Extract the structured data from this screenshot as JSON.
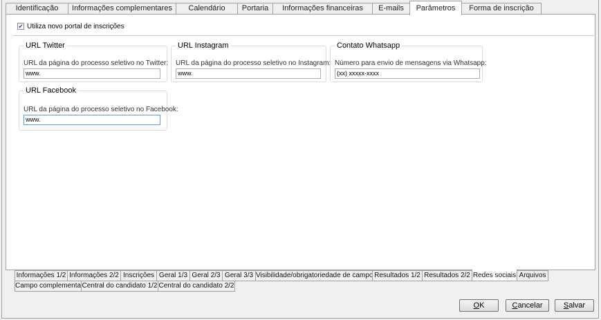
{
  "top_tabs": [
    {
      "label": "Identificação"
    },
    {
      "label": "Informações complementares"
    },
    {
      "label": "Calendário"
    },
    {
      "label": "Portaria"
    },
    {
      "label": "Informações financeiras"
    },
    {
      "label": "E-mails"
    },
    {
      "label": "Parâmetros"
    },
    {
      "label": "Forma de inscrição"
    }
  ],
  "active_top_tab": "Parâmetros",
  "new_portal": {
    "label": "Utiliza novo portal de inscrições",
    "checked": true
  },
  "groups": {
    "twitter": {
      "title": "URL Twitter",
      "label": "URL da página do processo seletivo no Twitter:",
      "value": "www."
    },
    "instagram": {
      "title": "URL Instagram",
      "label": "URL da página do processo seletivo no Instagram:",
      "value": "www."
    },
    "whatsapp": {
      "title": "Contato Whatsapp",
      "label": "Número para envio de mensagens via Whatsapp:",
      "value": "(xx) xxxxx-xxxx"
    },
    "facebook": {
      "title": "URL Facebook",
      "label": "URL da página do processo seletivo no Facebook:",
      "value": "www."
    }
  },
  "bottom_tabs_row1": [
    {
      "label": "Informações 1/2"
    },
    {
      "label": "Informações 2/2"
    },
    {
      "label": "Inscrições"
    },
    {
      "label": "Geral 1/3"
    },
    {
      "label": "Geral 2/3"
    },
    {
      "label": "Geral 3/3"
    },
    {
      "label": "Visibilidade/obrigatoriedade de campos"
    },
    {
      "label": "Resultados 1/2"
    },
    {
      "label": "Resultados 2/2"
    },
    {
      "label": "Redes sociais"
    },
    {
      "label": "Arquivos"
    }
  ],
  "bottom_tabs_row2": [
    {
      "label": "Campo complementar"
    },
    {
      "label": "Central do candidato 1/2"
    },
    {
      "label": "Central do candidato 2/2"
    }
  ],
  "active_bottom_tab": "Redes sociais",
  "buttons": {
    "ok": {
      "mnemonic": "O",
      "rest": "K"
    },
    "cancel": {
      "mnemonic": "C",
      "rest": "ancelar"
    },
    "save": {
      "mnemonic": "S",
      "rest": "alvar"
    }
  },
  "colors": {
    "accent_focus": "#569de5",
    "checkbox_mark": "#2a4f9b"
  }
}
